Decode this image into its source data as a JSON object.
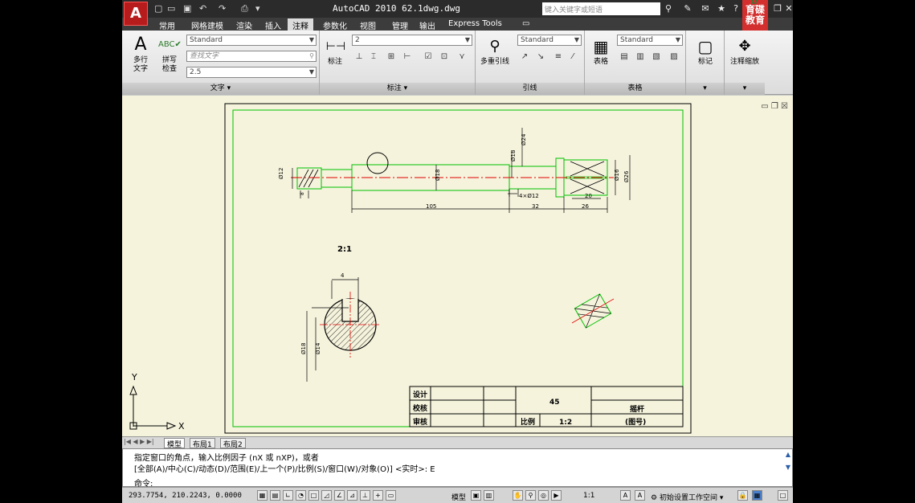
{
  "window": {
    "title": "AutoCAD 2010   62.1dwg.dwg",
    "search_placeholder": "键入关键字或短语",
    "brand_text": "育碟教育"
  },
  "tabs": [
    "常用",
    "网格建模",
    "渲染",
    "插入",
    "注释",
    "参数化",
    "视图",
    "管理",
    "输出",
    "Express Tools"
  ],
  "active_tab": "注释",
  "ribbon": {
    "text_panel": {
      "mtext_label": "多行\n文字",
      "spell_label": "拼写\n检查",
      "style_combo": "Standard",
      "find_placeholder": "查找文字",
      "height_combo": "2.5",
      "title": "文字"
    },
    "dim_panel": {
      "dim_label": "标注",
      "combo": "2",
      "title": "标注"
    },
    "leader_panel": {
      "mleader_label": "多重引线",
      "combo": "Standard",
      "title": "引线"
    },
    "table_panel": {
      "table_label": "表格",
      "combo": "Standard",
      "title": "表格"
    },
    "markup_panel": {
      "label": "标记"
    },
    "scale_panel": {
      "label": "注释缩放"
    }
  },
  "drawing": {
    "dims": {
      "d12": "Ø12",
      "d18": "Ø18",
      "d24": "Ø24",
      "d18b": "Ø18",
      "d16": "Ø16",
      "d26": "Ø26",
      "len105": "105",
      "len32": "32",
      "len26": "26",
      "len20": "20",
      "len8": "8",
      "w4xd12": "4×Ø12",
      "scale_label": "2:1",
      "sec4": "4",
      "sec18": "Ø18",
      "sec14": "Ø14"
    },
    "title_block": {
      "design": "设计",
      "check": "校核",
      "review": "审核",
      "material": "45",
      "name": "摇杆",
      "code": "(图号)",
      "scale_label": "比例",
      "scale_value": "1:2"
    },
    "ucs": {
      "y": "Y",
      "x": "X"
    }
  },
  "layout_tabs": [
    "模型",
    "布局1",
    "布局2"
  ],
  "command": {
    "line1": "指定窗口的角点，输入比例因子 (nX 或 nXP)，或者",
    "line2": "[全部(A)/中心(C)/动态(D)/范围(E)/上一个(P)/比例(S)/窗口(W)/对象(O)] <实时>: E",
    "prompt": "命令:"
  },
  "status": {
    "coords": "293.7754, 210.2243, 0.0000",
    "model": "模型",
    "scale": "1:1",
    "workspace": "初始设置工作空间"
  },
  "colors": {
    "drawing_bg": "#f5f3dc",
    "green": "#00c000",
    "red": "#e00000",
    "title_bar": "#2b2b2b"
  }
}
